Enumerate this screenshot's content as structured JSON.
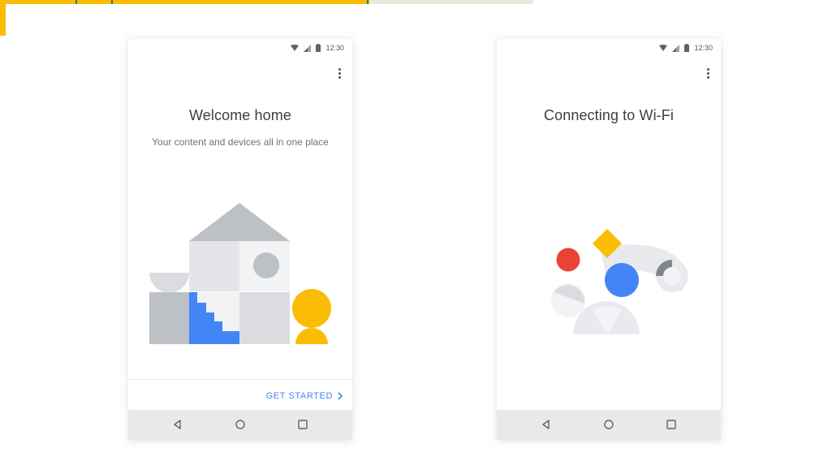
{
  "phone1": {
    "status_time": "12:30",
    "title": "Welcome home",
    "subtitle": "Your content and devices all in one place",
    "cta_label": "GET STARTED"
  },
  "phone2": {
    "status_time": "12:30",
    "title": "Connecting to Wi-Fi"
  },
  "icons": {
    "status": [
      "wifi-icon",
      "signal-icon",
      "battery-icon"
    ],
    "menu": "more-vert-icon",
    "cta": "chevron-right-icon",
    "nav": [
      "back-icon",
      "home-icon",
      "recents-icon"
    ]
  },
  "colors": {
    "accent_blue": "#4285f4",
    "google_red": "#ea4335",
    "google_yellow": "#fbbc04",
    "light_gray": "#dadce0",
    "mid_gray": "#bdc1c6",
    "nav_bar": "#e9e9e9"
  }
}
